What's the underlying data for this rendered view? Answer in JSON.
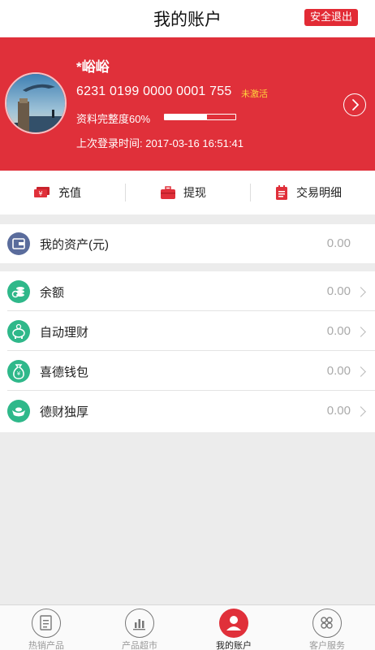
{
  "header": {
    "title": "我的账户",
    "logout_label": "安全退出"
  },
  "profile": {
    "username": "*峪峪",
    "card_number": "6231 0199 0000 0001 755",
    "card_status": "未激活",
    "completeness_label": "资料完整度60%",
    "completeness_value": 0.6,
    "last_login": "上次登录时间: 2017-03-16 16:51:41"
  },
  "actions": [
    {
      "label": "充值",
      "icon": "cash-icon"
    },
    {
      "label": "提现",
      "icon": "briefcase-icon"
    },
    {
      "label": "交易明细",
      "icon": "receipt-icon"
    }
  ],
  "assets": {
    "label": "我的资产(元)",
    "value": "0.00",
    "icon": "wallet-icon"
  },
  "list": [
    {
      "label": "余额",
      "value": "0.00",
      "icon": "coins-icon"
    },
    {
      "label": "自动理财",
      "value": "0.00",
      "icon": "piggy-bank-icon"
    },
    {
      "label": "喜德钱包",
      "value": "0.00",
      "icon": "money-bag-icon"
    },
    {
      "label": "德财独厚",
      "value": "0.00",
      "icon": "ingot-icon"
    }
  ],
  "tabs": [
    {
      "label": "热销产品",
      "icon": "hot-products-icon"
    },
    {
      "label": "产品超市",
      "icon": "bar-chart-icon"
    },
    {
      "label": "我的账户",
      "icon": "user-icon"
    },
    {
      "label": "客户服务",
      "icon": "service-icon"
    }
  ],
  "colors": {
    "brand_red": "#e0303a",
    "accent_yellow": "#ffd23c",
    "teal_icon": "#2fb88a",
    "slate_icon": "#5a6c9c"
  }
}
